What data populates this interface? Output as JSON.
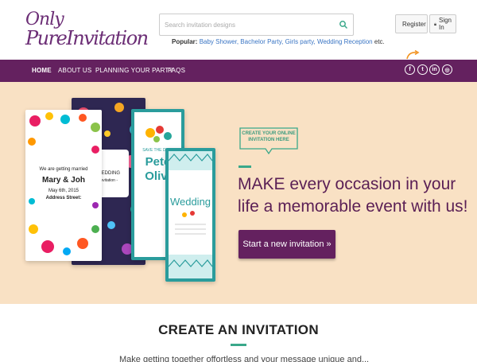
{
  "header": {
    "logo_line1": "Only",
    "logo_line2": "PureInvitation",
    "search_placeholder": "Search invitation designs",
    "popular_label": "Popular:",
    "popular_links": [
      "Baby Shower,",
      "Bachelor Party,",
      "Girls party,",
      "Wedding Reception"
    ],
    "popular_suffix": "etc.",
    "register_label": "Register",
    "signin_label": "Sign In"
  },
  "nav": {
    "items": [
      "HOME",
      "ABOUT US",
      "PLANNING YOUR PARTY",
      "FAQS"
    ],
    "social": [
      {
        "icon": "facebook-icon",
        "glyph": "f"
      },
      {
        "icon": "twitter-icon",
        "glyph": "t"
      },
      {
        "icon": "linkedin-icon",
        "glyph": "in"
      },
      {
        "icon": "instagram-icon",
        "glyph": "◎"
      }
    ]
  },
  "hero": {
    "card1": {
      "line1": "We are getting married",
      "names": "Mary & Joh",
      "date": "May 6th, 2015",
      "address": "Address Street:"
    },
    "card2": {
      "title": "WEDDING",
      "sub": "Invitation -"
    },
    "card3": {
      "save": "SAVE THE DATE",
      "names1": "Pete",
      "names2": "Olivi"
    },
    "card4": {
      "title": "Wedding"
    },
    "badge": "CREATE YOUR ONLINE INVITATION HERE",
    "title": "MAKE every occasion in your life a memorable event with us!",
    "cta_label": "Start a new invitation »"
  },
  "section": {
    "title": "CREATE AN INVITATION",
    "subtitle": "Make getting together offortless and your message unique and..."
  },
  "colors": {
    "brand_purple": "#64215f",
    "hero_bg": "#f9e1c4",
    "accent_green": "#3aa88a",
    "link_blue": "#3a75c4"
  }
}
